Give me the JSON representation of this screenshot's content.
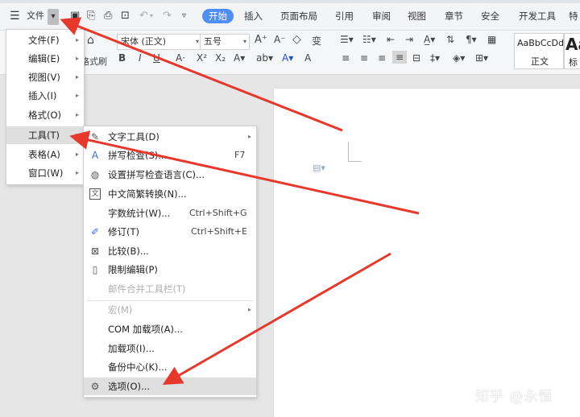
{
  "topbar": {
    "file_label": "文件",
    "tabs": [
      "开始",
      "插入",
      "页面布局",
      "引用",
      "审阅",
      "视图",
      "章节",
      "安全",
      "开发工具",
      "特"
    ],
    "active_tab": "开始"
  },
  "ribbon": {
    "format_painter": "格式刷",
    "font_name": "宋体 (正文)",
    "font_size": "五号",
    "style_sample": "AaBbCcDd",
    "style_name": "正文",
    "style2_sample": "Aa",
    "style2_name": "标"
  },
  "main_menu": [
    {
      "label": "文件(F)"
    },
    {
      "label": "编辑(E)"
    },
    {
      "label": "视图(V)"
    },
    {
      "label": "插入(I)"
    },
    {
      "label": "格式(O)"
    },
    {
      "label": "工具(T)"
    },
    {
      "label": "表格(A)"
    },
    {
      "label": "窗口(W)"
    }
  ],
  "tools_menu": [
    {
      "label": "文字工具(D)",
      "shortcut": "",
      "icon": "text-tool-icon"
    },
    {
      "label": "拼写检查(S)...",
      "shortcut": "F7",
      "icon": "spell-check-icon"
    },
    {
      "label": "设置拼写检查语言(C)...",
      "shortcut": "",
      "icon": "globe-language-icon"
    },
    {
      "label": "中文简繁转换(N)...",
      "shortcut": "",
      "icon": "chinese-convert-icon"
    },
    {
      "label": "字数统计(W)...",
      "shortcut": "Ctrl+Shift+G",
      "icon": ""
    },
    {
      "label": "修订(T)",
      "shortcut": "Ctrl+Shift+E",
      "icon": "revision-icon"
    },
    {
      "label": "比较(B)...",
      "shortcut": "",
      "icon": "compare-icon"
    },
    {
      "label": "限制编辑(P)",
      "shortcut": "",
      "icon": "restrict-edit-icon"
    },
    {
      "label": "邮件合并工具栏(T)",
      "shortcut": "",
      "icon": ""
    },
    {
      "label": "宏(M)",
      "shortcut": "",
      "icon": ""
    },
    {
      "label": "COM 加载项(A)...",
      "shortcut": "",
      "icon": ""
    },
    {
      "label": "加载项(I)...",
      "shortcut": "",
      "icon": ""
    },
    {
      "label": "备份中心(K)...",
      "shortcut": "",
      "icon": ""
    },
    {
      "label": "选项(O)...",
      "shortcut": "",
      "icon": "gear-icon"
    }
  ],
  "watermark": "知乎 @永恒",
  "colors": {
    "accent": "#4e8ef7",
    "arrow": "#e8382c",
    "highlight": "#dfdfdf",
    "disabled": "#b0b0b0"
  }
}
